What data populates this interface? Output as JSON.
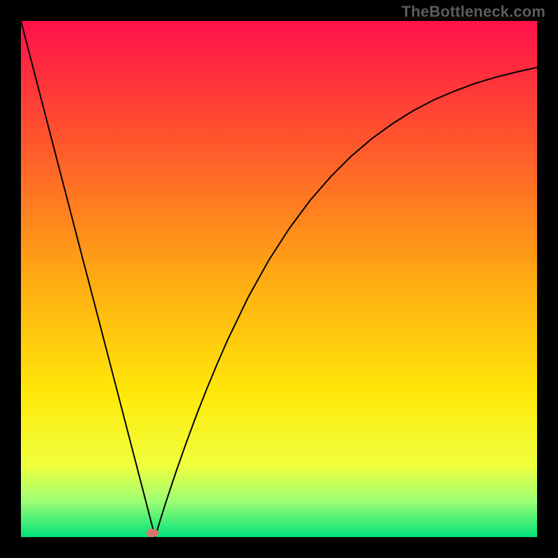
{
  "watermark": "TheBottleneck.com",
  "chart_data": {
    "type": "line",
    "title": "",
    "xlabel": "",
    "ylabel": "",
    "xlim": [
      0,
      100
    ],
    "ylim": [
      0,
      100
    ],
    "grid": false,
    "legend": false,
    "background_gradient": {
      "stops": [
        {
          "offset": 0.0,
          "color": "#ff114a"
        },
        {
          "offset": 0.25,
          "color": "#ff5b2b"
        },
        {
          "offset": 0.5,
          "color": "#ffaa12"
        },
        {
          "offset": 0.72,
          "color": "#ffe80a"
        },
        {
          "offset": 0.86,
          "color": "#f0ff3d"
        },
        {
          "offset": 0.93,
          "color": "#9eff74"
        },
        {
          "offset": 1.0,
          "color": "#00e27a"
        }
      ]
    },
    "series": [
      {
        "name": "curve",
        "color": "#000000",
        "x": [
          0,
          2,
          4,
          6,
          8,
          10,
          12,
          14,
          16,
          18,
          20,
          22,
          24,
          25,
          26,
          27,
          28,
          30,
          32,
          34,
          36,
          38,
          40,
          44,
          48,
          52,
          56,
          60,
          64,
          68,
          72,
          76,
          80,
          84,
          88,
          92,
          96,
          100
        ],
        "y": [
          100,
          92.3,
          84.6,
          76.9,
          69.2,
          61.5,
          53.8,
          46.2,
          38.5,
          30.8,
          23.1,
          15.4,
          7.7,
          3.8,
          0,
          3.3,
          6.5,
          12.5,
          18.2,
          23.6,
          28.7,
          33.5,
          38.1,
          46.4,
          53.6,
          59.8,
          65.2,
          69.8,
          73.8,
          77.2,
          80.1,
          82.6,
          84.7,
          86.4,
          87.9,
          89.1,
          90.1,
          91.0
        ]
      }
    ],
    "markers": [
      {
        "name": "vertex-marker",
        "shape": "ellipse",
        "x": 25.5,
        "y": 0.8,
        "rx": 1.2,
        "ry": 0.8,
        "color": "#d9746c"
      }
    ]
  }
}
